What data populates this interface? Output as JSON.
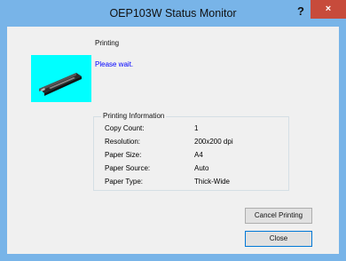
{
  "window": {
    "title": "OEP103W Status Monitor",
    "help_glyph": "?",
    "close_glyph": "×"
  },
  "status": {
    "heading": "Printing",
    "message": "Please wait."
  },
  "printing_info": {
    "legend": "Printing Information",
    "rows": [
      {
        "label": "Copy Count:",
        "value": "1"
      },
      {
        "label": "Resolution:",
        "value": "200x200 dpi"
      },
      {
        "label": "Paper Size:",
        "value": "A4"
      },
      {
        "label": "Paper Source:",
        "value": "Auto"
      },
      {
        "label": "Paper Type:",
        "value": "Thick-Wide"
      }
    ]
  },
  "buttons": {
    "cancel_printing": "Cancel Printing",
    "close": "Close"
  },
  "colors": {
    "titlebar": "#78b4e8",
    "close_button": "#c74b3b",
    "status_message": "#0000ff",
    "printer_background": "#00ffff"
  },
  "icons": {
    "printer": "mobile-printer-icon"
  }
}
